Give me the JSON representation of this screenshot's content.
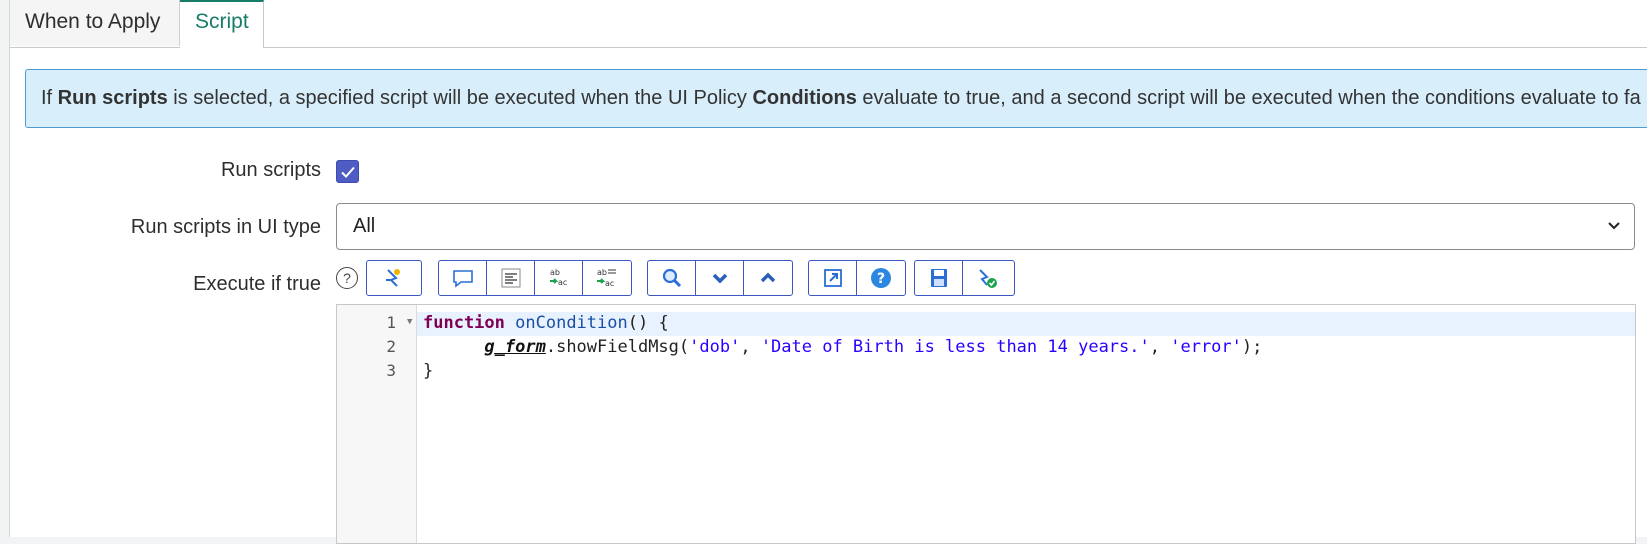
{
  "tabs": [
    {
      "label": "When to Apply",
      "active": false
    },
    {
      "label": "Script",
      "active": true
    }
  ],
  "banner": {
    "part1": "If ",
    "bold1": "Run scripts",
    "part2": " is selected, a specified script will be executed when the UI Policy ",
    "bold2": "Conditions",
    "part3": " evaluate to true, and a second script will be executed when the conditions evaluate to fa"
  },
  "form": {
    "run_scripts_label": "Run scripts",
    "run_scripts_checked": true,
    "ui_type_label": "Run scripts in UI type",
    "ui_type_value": "All",
    "execute_label": "Execute if true",
    "help_glyph": "?"
  },
  "toolbar_icons": [
    "script-debug-icon",
    "comment-icon",
    "format-icon",
    "replace-icon",
    "replace-all-icon",
    "search-icon",
    "next-icon",
    "previous-icon",
    "fullscreen-icon",
    "help-icon",
    "save-icon",
    "syntax-check-icon"
  ],
  "editor": {
    "line_numbers": [
      "1",
      "2",
      "3"
    ],
    "line1_kw": "function",
    "line1_fn": "onCondition",
    "line1_rest": "() {",
    "line2_indent": "      ",
    "line2_obj": "g_form",
    "line2_method": ".showFieldMsg(",
    "line2_str1": "'dob'",
    "line2_sep1": ", ",
    "line2_str2": "'Date of Birth is less than 14 years.'",
    "line2_sep2": ", ",
    "line2_str3": "'error'",
    "line2_end": ");",
    "line3": "}"
  },
  "colors": {
    "accent": "#177c68",
    "checkbox": "#4e5cc4",
    "banner_bg": "#d8effb",
    "banner_border": "#4f9bd1",
    "toolbar_border": "#3a57c2"
  }
}
